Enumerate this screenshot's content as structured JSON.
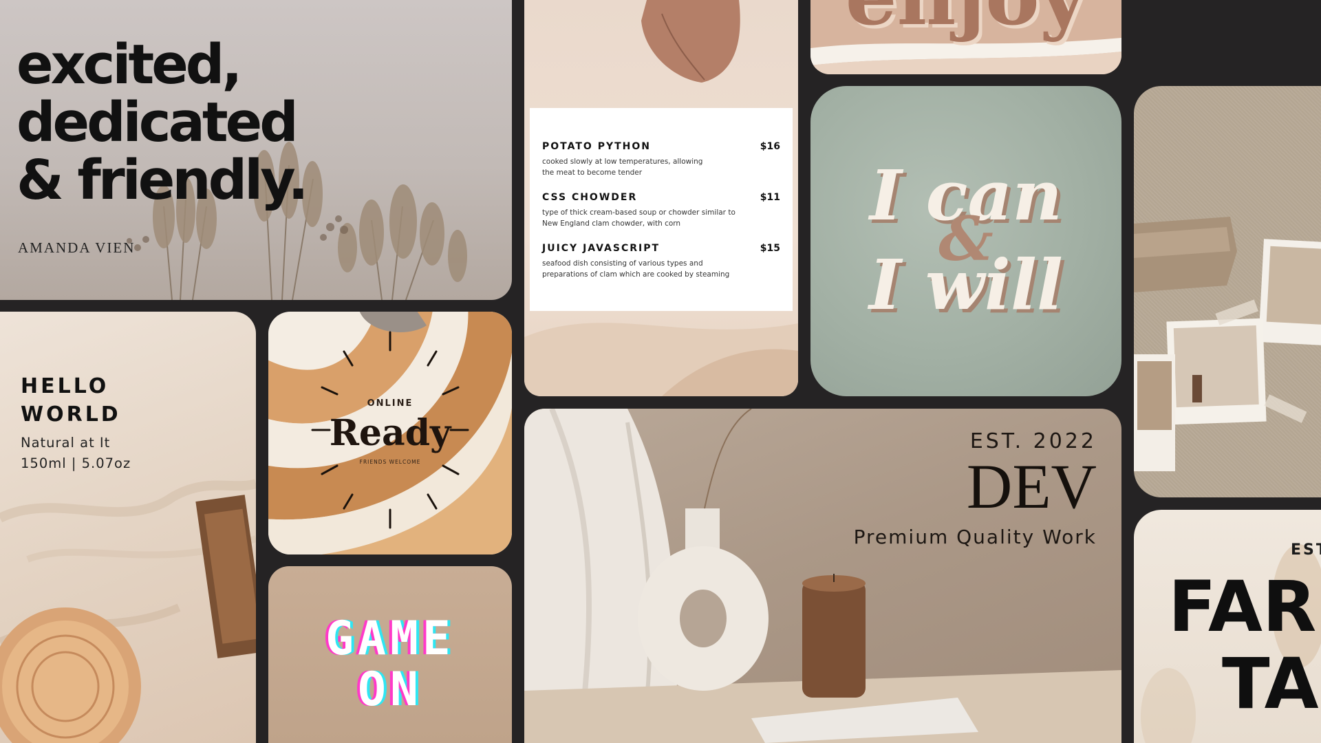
{
  "quote_card": {
    "line1": "excited,",
    "line2": "dedicated",
    "line3": "& friendly.",
    "author": "AMANDA VIEN"
  },
  "menu_card": {
    "items": [
      {
        "name": "POTATO PYTHON",
        "price": "$16",
        "desc1": "cooked slowly at low temperatures, allowing",
        "desc2": "the meat to become tender"
      },
      {
        "name": "CSS CHOWDER",
        "price": "$11",
        "desc1": "type of thick cream-based soup or chowder similar to",
        "desc2": "New England clam chowder, with corn"
      },
      {
        "name": "JUICY JAVASCRIPT",
        "price": "$15",
        "desc1": "seafood dish consisting of various types and",
        "desc2": "preparations of clam which are cooked by steaming"
      }
    ]
  },
  "enjoy_card": {
    "word": "enjoy"
  },
  "ican_card": {
    "line1": "I can",
    "amp": "&",
    "line2": "I will"
  },
  "hello_card": {
    "title1": "HELLO",
    "title2": "WORLD",
    "sub1": "Natural at It",
    "sub2": "150ml | 5.07oz"
  },
  "ready_card": {
    "online": "ONLINE",
    "ready": "Ready",
    "welcome": "FRIENDS WELCOME"
  },
  "game_card": {
    "line1": "GAME",
    "line2": "ON"
  },
  "dev_card": {
    "est": "EST. 2022",
    "title": "DEV",
    "tagline": "Premium Quality Work"
  },
  "farm_card": {
    "est": "EST",
    "line1": "FAR",
    "line2": "TA"
  },
  "colors": {
    "background": "#252324",
    "menu_text": "#111111",
    "ican_text": "#f6efe6",
    "ican_shadow": "#a58471",
    "game_magenta": "#ff39c8",
    "game_cyan": "#2fe6f2"
  }
}
